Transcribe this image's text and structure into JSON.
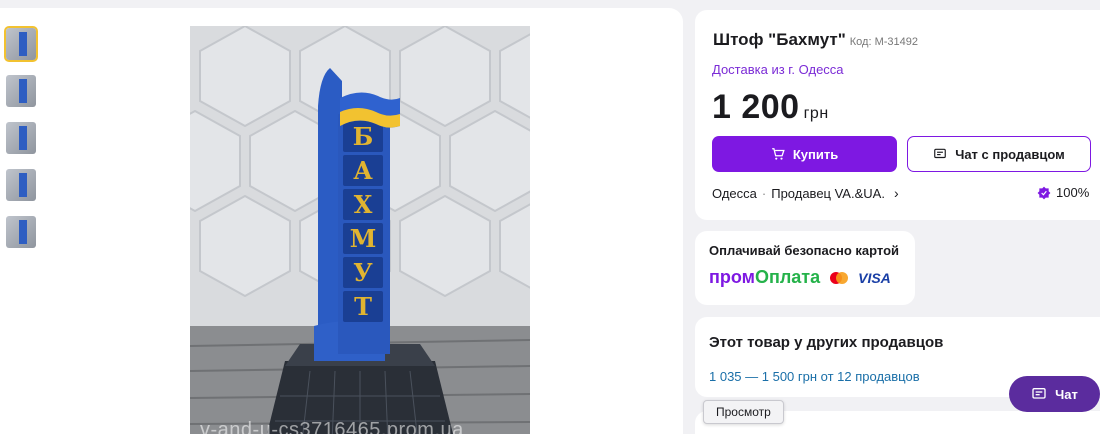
{
  "product": {
    "title": "Штоф \"Бахмут\"",
    "code": "Код: М-31492",
    "delivery": "Доставка из г. Одесса",
    "price": "1 200",
    "currency": "грн",
    "buy_label": "Купить",
    "chat_label": "Чат с продавцом",
    "city": "Одесса",
    "seller": "Продавец VA.&UA.",
    "rating": "100%"
  },
  "payment": {
    "title": "Оплачивай безопасно картой",
    "brand_part1": "пром",
    "brand_part2": "Оплата",
    "visa": "VISA"
  },
  "other_sellers": {
    "title": "Этот товар у других продавцов",
    "range": "1 035 — 1 500 грн  от 12 продавцов"
  },
  "gallery": {
    "thumb_count": 5,
    "watermark": "v-and-u-cs3716465.prom.ua",
    "stele_letters": [
      "Б",
      "А",
      "Х",
      "М",
      "У",
      "Т"
    ]
  },
  "floating": {
    "chat_label": "Чат",
    "tooltip": "Просмотр"
  },
  "colors": {
    "accent": "#7e18e2",
    "green": "#25b24a",
    "link": "#1a6fa8",
    "stele_blue": "#2e5ec2",
    "flag_yellow": "#f2c230"
  }
}
